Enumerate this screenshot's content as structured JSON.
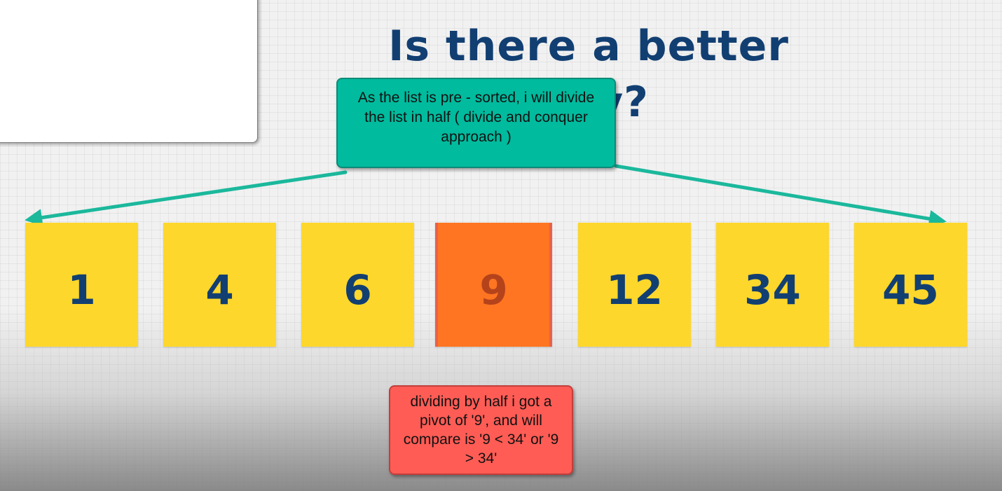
{
  "title": "Is there a better way?",
  "callout_top": {
    "text": "As the list is pre - sorted, i will divide the list in half ( divide and conquer approach )"
  },
  "callout_bottom": {
    "text": "dividing by half i got a pivot of '9', and will compare is '9 < 34' or '9 > 34'"
  },
  "list": {
    "values": [
      "1",
      "4",
      "6",
      "9",
      "12",
      "34",
      "45"
    ],
    "pivot_index": 3
  },
  "colors": {
    "title": "#123f72",
    "box": "#fdd72b",
    "pivot_box": "#ff7521",
    "teal_callout": "#00bb9e",
    "red_callout": "#ff5c55",
    "arrow": "#1bb89c"
  }
}
